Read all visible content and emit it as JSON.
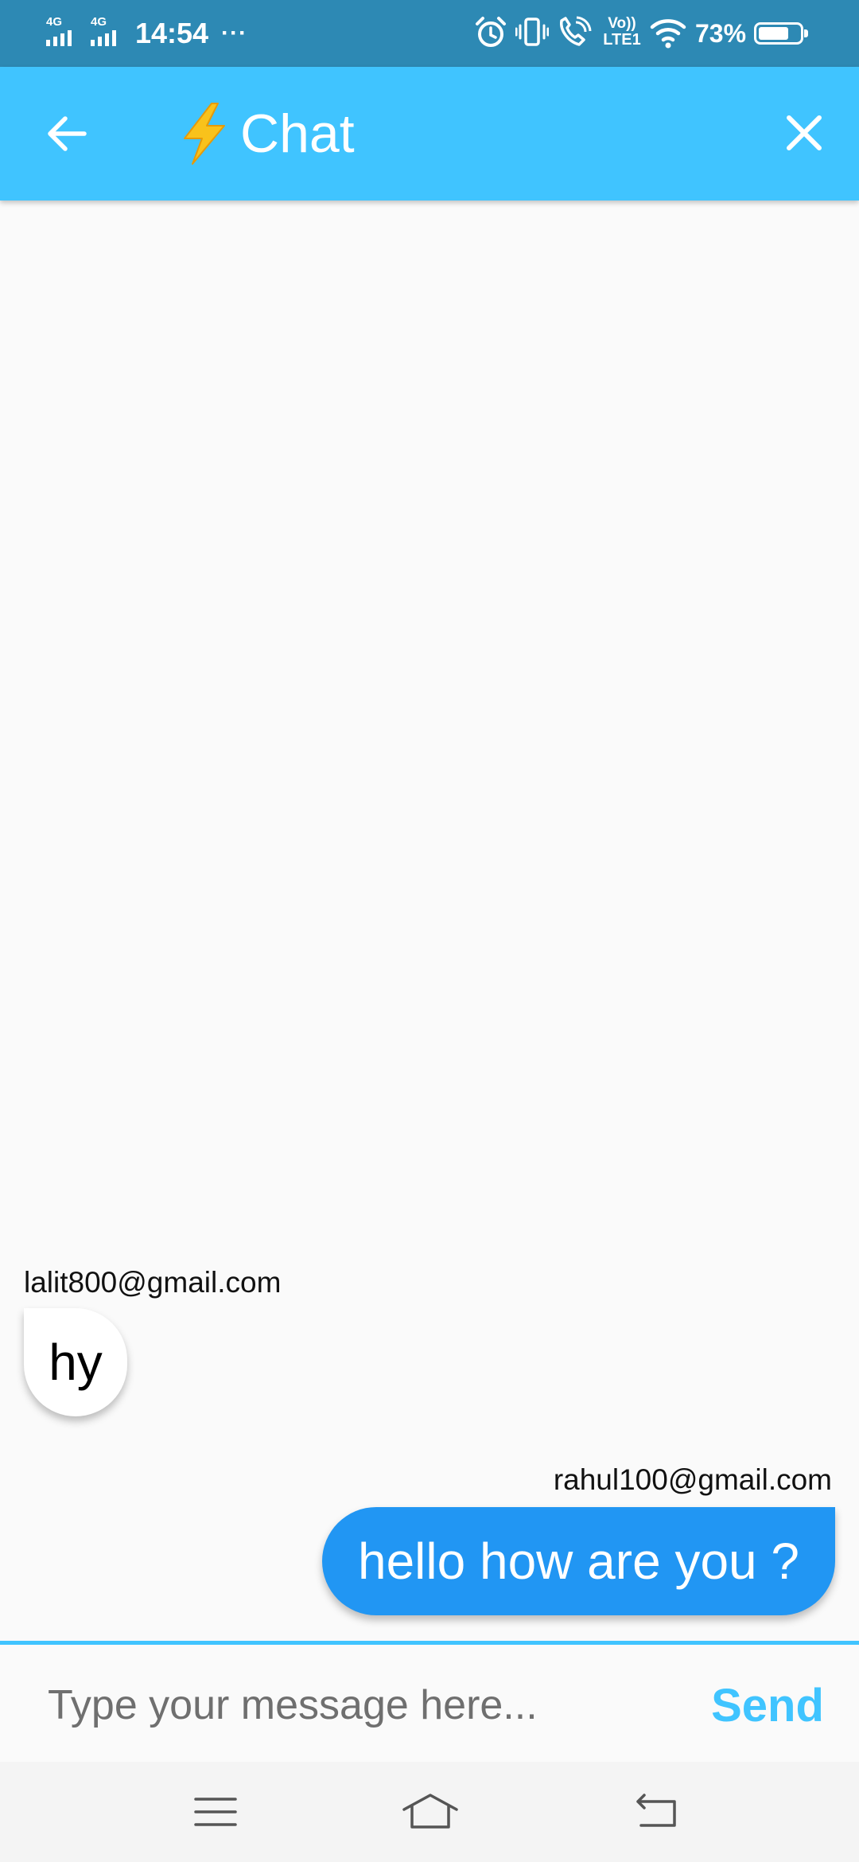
{
  "status_bar": {
    "network_1": "4G",
    "network_2": "4G",
    "time": "14:54",
    "more_indicator": "···",
    "volte_line1": "Vo))",
    "volte_line2": "LTE1",
    "battery_percent": "73%",
    "battery_level": 0.73,
    "icons": [
      "signal-icon",
      "alarm-icon",
      "vibrate-icon",
      "wifi-calling-icon",
      "wifi-icon",
      "battery-icon"
    ]
  },
  "app_bar": {
    "title": "Chat",
    "title_icon": "lightning-bolt-icon",
    "back_icon": "arrow-back-icon",
    "close_icon": "close-icon",
    "background_color": "#40c4ff"
  },
  "messages": [
    {
      "sender": "lalit800@gmail.com",
      "text": "hy",
      "direction": "received"
    },
    {
      "sender": "rahul100@gmail.com",
      "text": "hello how are you ?",
      "direction": "sent"
    }
  ],
  "composer": {
    "value": "",
    "placeholder": "Type your message here...",
    "send_label": "Send",
    "accent_color": "#40c4ff"
  },
  "nav_bar": {
    "icons": [
      "menu-icon",
      "home-icon",
      "back-nav-icon"
    ]
  },
  "colors": {
    "sent_bubble": "#2196f3",
    "received_bubble": "#ffffff",
    "status_bar": "#2d89b4"
  }
}
